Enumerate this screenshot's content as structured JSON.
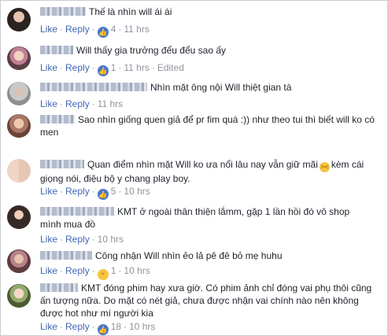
{
  "actions": {
    "like": "Like",
    "reply": "Reply"
  },
  "comments": [
    {
      "text": "Thế là nhìn will ái ái",
      "reaction_count": "4",
      "time": "11 hrs",
      "edited": ""
    },
    {
      "text": "Will thấy gia trưởng đểu đểu sao ấy",
      "reaction_count": "1",
      "time": "11 hrs",
      "edited": "Edited"
    },
    {
      "text": "Nhìn mặt ông nội Will thiệt gian tà",
      "reaction_count": "",
      "time": "11 hrs",
      "edited": ""
    },
    {
      "text": "Sao nhìn giống quen giả để pr fim quá :)) như theo tui thì biết will ko có men",
      "reaction_count": "",
      "time": "",
      "edited": ""
    },
    {
      "text_before": "Quan điểm nhìn mặt Will ko ưa nổi lâu nay vẫn giữ mãi",
      "emoji": "confounded-face",
      "text_after": "kèm cái giọng nói, điệu bộ y chang play boy.",
      "reaction_count": "5",
      "time": "10 hrs",
      "edited": ""
    },
    {
      "text": "KMT ở ngoài thân thiện lắmm, gặp 1 lần hồi đó vô shop mình mua đồ",
      "reaction_count": "",
      "time": "10 hrs",
      "edited": ""
    },
    {
      "text": "Công nhận Will nhìn ẻo lả pê đê bỏ mẹ huhu",
      "reaction_count": "1",
      "time": "10 hrs",
      "edited": ""
    },
    {
      "text": "KMT đóng phim hay xưa giờ. Có phim ảnh chỉ đóng vai phụ thôi cũng ấn tượng nữa. Do mặt có nét giả, chưa được nhận vai chính nào nên không được hot như mí người kia",
      "reaction_count": "18",
      "time": "10 hrs",
      "edited": ""
    }
  ],
  "colors": {
    "link": "#4267b2",
    "meta": "#90949c",
    "text": "#1d2129",
    "like_reaction": "#4a76d0",
    "haha_reaction": "#f7c33c"
  },
  "icons": {
    "like_reaction": "thumbs-up-icon",
    "haha_reaction": "laughing-face-icon"
  }
}
